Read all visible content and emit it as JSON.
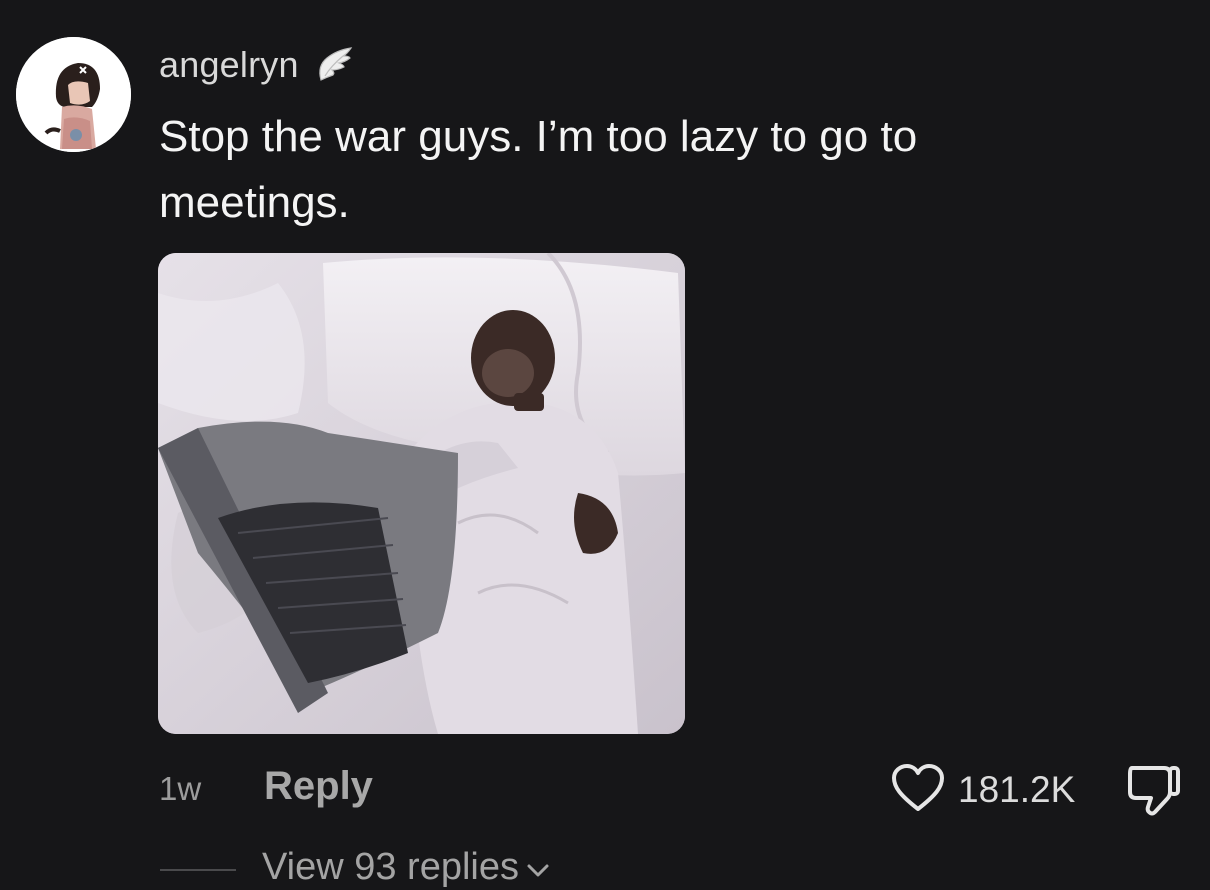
{
  "comment": {
    "username": "angelryn",
    "username_badge_icon": "angel-wing-icon",
    "text": "Stop the war guys. I’m too lazy to go to meetings.",
    "media_icon": "monkey-typing-on-laptop-image",
    "timestamp": "1w",
    "reply_label": "Reply",
    "like_icon": "heart-outline-icon",
    "like_count": "181.2K",
    "dislike_icon": "thumbs-down-icon",
    "view_replies_label": "View 93 replies",
    "view_replies_icon": "chevron-down-icon"
  },
  "colors": {
    "background": "#161618",
    "primary_text": "#f4f4f4",
    "secondary_text": "#a8a8a8"
  }
}
